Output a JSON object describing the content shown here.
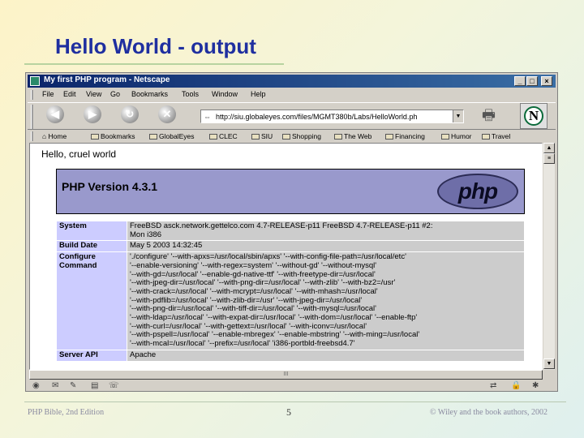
{
  "slide": {
    "title": "Hello World - output",
    "footer_left": "PHP Bible, 2nd Edition",
    "footer_page": "5",
    "footer_right": "© Wiley and the book authors, 2002"
  },
  "browser": {
    "window_title": "My first PHP program - Netscape",
    "menu": [
      "File",
      "Edit",
      "View",
      "Go",
      "Bookmarks",
      "Tools",
      "Window",
      "Help"
    ],
    "nav_buttons": [
      "",
      "",
      "",
      ""
    ],
    "url": "http://siu.globaleyes.com/files/MGMT380b/Labs/HelloWorld.ph",
    "bookmarks": [
      "Home",
      "Bookmarks",
      "GlobalEyes",
      "CLEC",
      "SIU",
      "Shopping",
      "The Web",
      "Financing",
      "Humor",
      "Travel"
    ],
    "scroll_label": "III"
  },
  "page": {
    "hello": "Hello, cruel world",
    "php_version": "PHP Version 4.3.1",
    "php_logo_text": "php",
    "rows": [
      {
        "key": "System",
        "lines": [
          "FreeBSD asck.network.gettelco.com 4.7-RELEASE-p11 FreeBSD 4.7-RELEASE-p11 #2:",
          "Mon i386"
        ]
      },
      {
        "key": "Build Date",
        "lines": [
          "May 5 2003 14:32:45"
        ]
      },
      {
        "key": "Configure Command",
        "lines": [
          "'./configure' '--with-apxs=/usr/local/sbin/apxs' '--with-config-file-path=/usr/local/etc'",
          "'--enable-versioning' '--with-regex=system' '--without-gd' '--without-mysql'",
          "'--with-gd=/usr/local' '--enable-gd-native-ttf' '--with-freetype-dir=/usr/local'",
          "'--with-jpeg-dir=/usr/local' '--with-png-dir=/usr/local' '--with-zlib' '--with-bz2=/usr'",
          "'--with-crack=/usr/local' '--with-mcrypt=/usr/local' '--with-mhash=/usr/local'",
          "'--with-pdflib=/usr/local' '--with-zlib-dir=/usr' '--with-jpeg-dir=/usr/local'",
          "'--with-png-dir=/usr/local' '--with-tiff-dir=/usr/local' '--with-mysql=/usr/local'",
          "'--with-ldap=/usr/local' '--with-expat-dir=/usr/local' '--with-dom=/usr/local' '--enable-ftp'",
          "'--with-curl=/usr/local' '--with-gettext=/usr/local' '--with-iconv=/usr/local'",
          "'--with-pspell=/usr/local' '--enable-mbregex' '--enable-mbstring' '--with-ming=/usr/local'",
          "'--with-mcal=/usr/local' '--prefix=/usr/local' 'i386-portbld-freebsd4.7'"
        ]
      },
      {
        "key": "Server API",
        "lines": [
          "Apache"
        ]
      }
    ]
  }
}
